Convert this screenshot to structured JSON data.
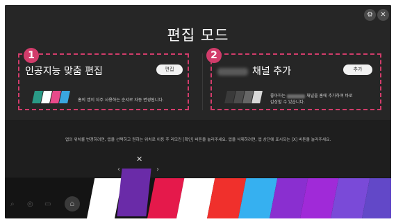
{
  "screen": {
    "title": "편집 모드"
  },
  "top_buttons": {
    "settings_icon": "gear-icon",
    "close_icon": "close-icon"
  },
  "panels": [
    {
      "badge": "1",
      "title": "인공지능 맞춤 편집",
      "button_label": "편집",
      "description": "홈의 앱이 자주 사용하는 순서로 자동 변경됩니다."
    },
    {
      "badge": "2",
      "title_suffix": "채널 추가",
      "button_label": "추가",
      "description_line1_a": "좋아하는",
      "description_line1_b": "채널을 홈에 추가하여 바로",
      "description_line2": "감상할 수 있습니다."
    }
  ],
  "instruction": "앱의 위치를 변경하려면, 앱을 선택하고 원하는 위치로 이동 후 리모컨 [확인] 버튼을 눌러주세요. 앱을 삭제하려면, 앱 상단에 표시되는 [X] 버튼을 눌러주세요.",
  "selected_app": {
    "close_symbol": "✕",
    "left_arrow": "‹",
    "right_arrow": "›"
  },
  "colors": {
    "accent": "#d23c6b",
    "tiles": [
      "#ffffff",
      "#e5194b",
      "#ffffff",
      "#f0302c",
      "#36b0f0",
      "#8a2fd0",
      "#a02ad8",
      "#7a4ad8",
      "#6248c8"
    ]
  }
}
